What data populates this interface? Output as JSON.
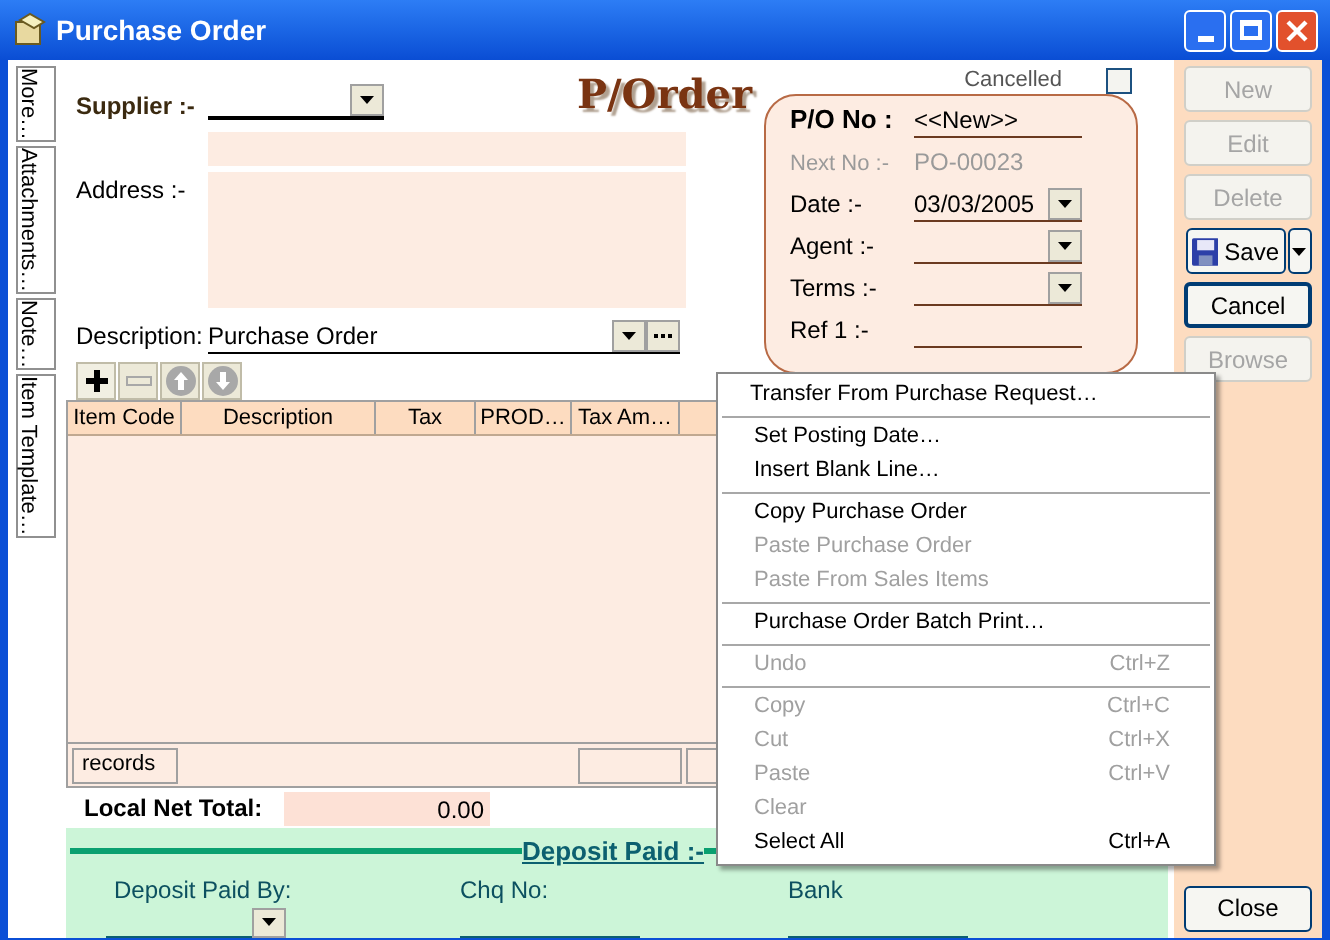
{
  "window": {
    "title": "Purchase Order"
  },
  "side_tabs": [
    {
      "label": "More…"
    },
    {
      "label": "Attachments…"
    },
    {
      "label": "Note…"
    },
    {
      "label": "Item Template…"
    }
  ],
  "logo": "P/Order",
  "supplier": {
    "label": "Supplier :-"
  },
  "address": {
    "label": "Address :-"
  },
  "description": {
    "label": "Description:",
    "value": "Purchase Order"
  },
  "cancelled": {
    "label": "Cancelled",
    "checked": false
  },
  "po": [
    {
      "label": "P/O No :",
      "value": "<<New>>",
      "kind": "heading"
    },
    {
      "label": "Next No :-",
      "value": "PO-00023",
      "kind": "info"
    },
    {
      "label": "Date :-",
      "value": "03/03/2005",
      "kind": "dropdown"
    },
    {
      "label": "Agent :-",
      "kind": "dropdown"
    },
    {
      "label": "Terms :-",
      "kind": "dropdown"
    },
    {
      "label": "Ref 1 :-",
      "kind": "text"
    }
  ],
  "toolbar": [
    {
      "kind": "add",
      "disabled": false
    },
    {
      "kind": "remove",
      "disabled": true
    },
    {
      "kind": "up",
      "disabled": true
    },
    {
      "kind": "down",
      "disabled": true
    }
  ],
  "grid": {
    "columns": [
      "Item Code",
      "Description",
      "Tax",
      "PROD…",
      "Tax Am…"
    ],
    "footer": "records"
  },
  "local_net_total": {
    "label": "Local Net Total:",
    "value": "0.00"
  },
  "deposit": {
    "title": "Deposit Paid :-",
    "fields": [
      {
        "label": "Deposit Paid By:",
        "kind": "dropdown"
      },
      {
        "label": "Chq No:",
        "kind": "text"
      },
      {
        "label": "Bank",
        "kind": "text"
      }
    ]
  },
  "buttons": [
    {
      "label": "New",
      "disabled": true,
      "kind": "plain"
    },
    {
      "label": "Edit",
      "disabled": true,
      "kind": "plain"
    },
    {
      "label": "Delete",
      "disabled": true,
      "kind": "plain"
    },
    {
      "label": "Save",
      "disabled": false,
      "kind": "split"
    },
    {
      "label": "Cancel",
      "disabled": false,
      "kind": "default"
    },
    {
      "label": "Browse",
      "disabled": true,
      "kind": "plain"
    }
  ],
  "close_button": {
    "label": "Close"
  },
  "context_menu": [
    [
      {
        "label": "Transfer From Purchase Request…",
        "disabled": false
      }
    ],
    [
      {
        "label": "Set Posting Date…",
        "disabled": false
      },
      {
        "label": "Insert Blank Line…",
        "disabled": false
      }
    ],
    [
      {
        "label": "Copy Purchase Order",
        "disabled": false
      },
      {
        "label": "Paste Purchase Order",
        "disabled": true
      },
      {
        "label": "Paste From Sales Items",
        "disabled": true
      }
    ],
    [
      {
        "label": "Purchase Order Batch Print…",
        "disabled": false
      }
    ],
    [
      {
        "label": "Undo",
        "shortcut": "Ctrl+Z",
        "disabled": true
      }
    ],
    [
      {
        "label": "Copy",
        "shortcut": "Ctrl+C",
        "disabled": true
      },
      {
        "label": "Cut",
        "shortcut": "Ctrl+X",
        "disabled": true
      },
      {
        "label": "Paste",
        "shortcut": "Ctrl+V",
        "disabled": true
      },
      {
        "label": "Clear",
        "disabled": true
      },
      {
        "label": "Select All",
        "shortcut": "Ctrl+A",
        "disabled": false
      }
    ]
  ]
}
